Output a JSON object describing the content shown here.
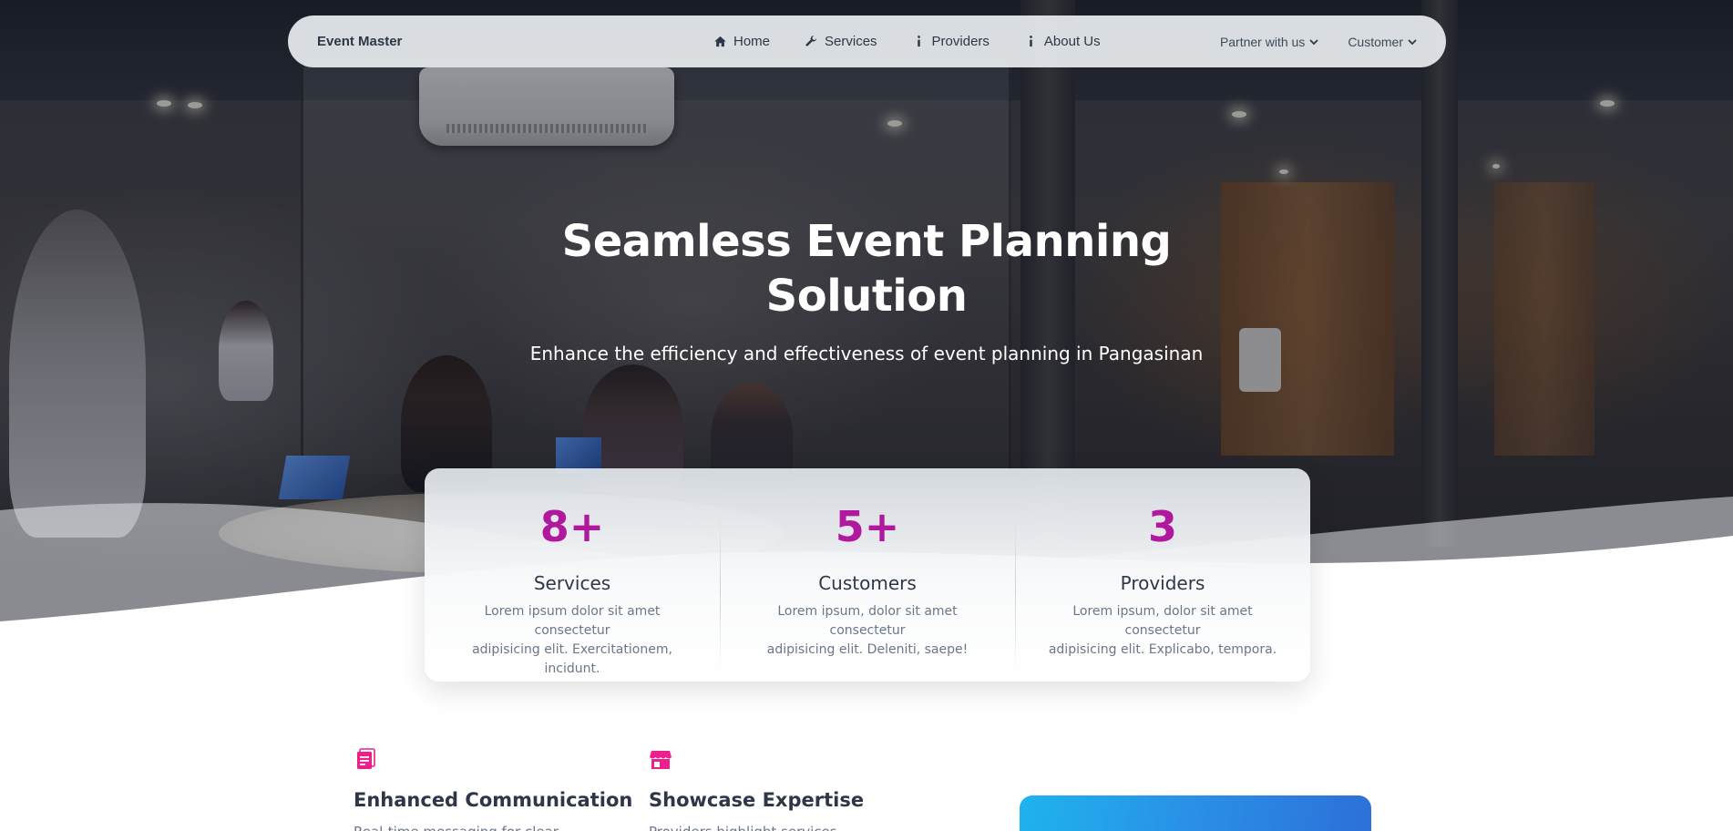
{
  "nav": {
    "brand": "Event Master",
    "links": [
      {
        "label": "Home",
        "icon": "home-icon"
      },
      {
        "label": "Services",
        "icon": "wrench-icon"
      },
      {
        "label": "Providers",
        "icon": "info-icon"
      },
      {
        "label": "About Us",
        "icon": "info-icon"
      }
    ],
    "dropdowns": [
      {
        "label": "Partner with us",
        "icon": "chevron-down-icon"
      },
      {
        "label": "Customer",
        "icon": "chevron-down-icon"
      }
    ]
  },
  "hero": {
    "title_line1": "Seamless Event Planning",
    "title_line2": "Solution",
    "subtitle": "Enhance the efficiency and effectiveness of event planning in Pangasinan"
  },
  "stats": [
    {
      "value": "8+",
      "label": "Services",
      "desc_line1": "Lorem ipsum dolor sit amet consectetur",
      "desc_line2": "adipisicing elit. Exercitationem, incidunt."
    },
    {
      "value": "5+",
      "label": "Customers",
      "desc_line1": "Lorem ipsum, dolor sit amet consectetur",
      "desc_line2": "adipisicing elit. Deleniti, saepe!"
    },
    {
      "value": "3",
      "label": "Providers",
      "desc_line1": "Lorem ipsum, dolor sit amet consectetur",
      "desc_line2": "adipisicing elit. Explicabo, tempora."
    }
  ],
  "features": [
    {
      "title": "Enhanced Communication",
      "desc": "Real-time messaging for clear",
      "icon": "document-icon"
    },
    {
      "title": "Showcase Expertise",
      "desc": "Providers highlight services",
      "icon": "store-icon"
    }
  ],
  "colors": {
    "accent": "#b0189e",
    "feature_icon": "#ec1f8c",
    "heading": "#2d3748",
    "muted": "#6b7789",
    "blue_card": "#2a8fe6"
  }
}
